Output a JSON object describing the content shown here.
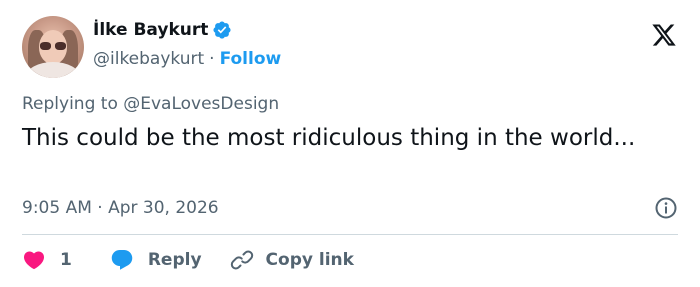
{
  "author": {
    "display_name": "İlke Baykurt",
    "handle": "@ilkebaykurt",
    "separator": "·",
    "follow_label": "Follow",
    "verified_color": "#1d9bf0"
  },
  "tweet": {
    "replying_to": "Replying to @EvaLovesDesign",
    "text": "This could be the most ridiculous thing in the world...",
    "timestamp": "9:05 AM · Apr 30, 2026"
  },
  "actions": {
    "like_count": "1",
    "reply_label": "Reply",
    "copy_link_label": "Copy link"
  },
  "colors": {
    "accent": "#1d9bf0",
    "like": "#f91880",
    "secondary_text": "#536471",
    "primary_text": "#0f1419"
  },
  "icons": [
    "verified-badge-icon",
    "x-logo-icon",
    "info-icon",
    "heart-icon",
    "reply-bubble-icon",
    "link-icon"
  ]
}
